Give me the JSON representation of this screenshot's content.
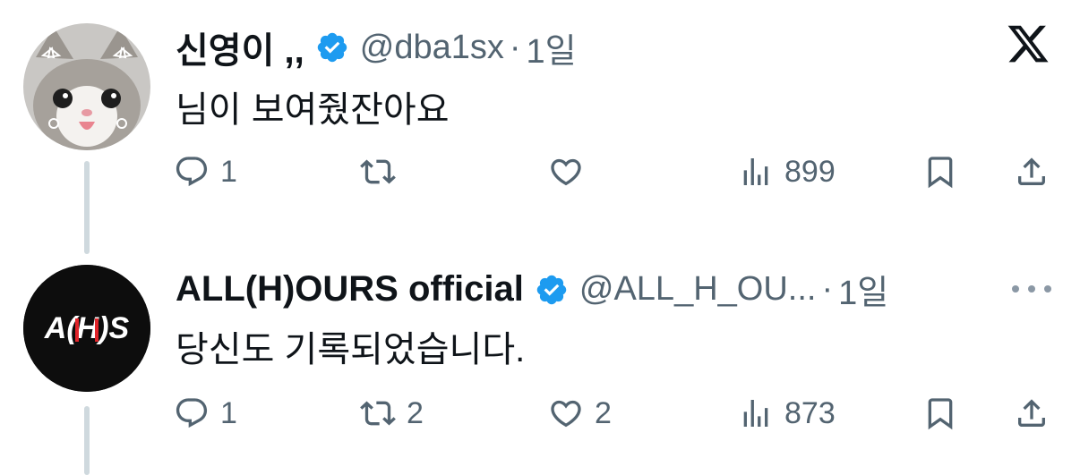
{
  "tweets": [
    {
      "display_name": "신영이 ,,",
      "handle": "@dba1sx",
      "separator": "·",
      "time": "1일",
      "text": "님이 보여줬잔아요",
      "avatar": "cat-avatar-with-ribbons",
      "actions": {
        "reply": {
          "icon": "reply-icon",
          "count": "1"
        },
        "repost": {
          "icon": "repost-icon",
          "count": ""
        },
        "like": {
          "icon": "heart-icon",
          "count": ""
        },
        "views": {
          "icon": "views-icon",
          "count": "899"
        },
        "bookmark": {
          "icon": "bookmark-icon"
        },
        "share": {
          "icon": "share-icon"
        }
      }
    },
    {
      "display_name": "ALL(H)OURS official",
      "handle": "@ALL_H_OU...",
      "separator": "·",
      "time": "1일",
      "text": "당신도 기록되었습니다.",
      "avatar": "allhours-logo",
      "avatar_logo_text": "A(H)S",
      "actions": {
        "reply": {
          "icon": "reply-icon",
          "count": "1"
        },
        "repost": {
          "icon": "repost-icon",
          "count": "2"
        },
        "like": {
          "icon": "heart-icon",
          "count": "2"
        },
        "views": {
          "icon": "views-icon",
          "count": "873"
        },
        "bookmark": {
          "icon": "bookmark-icon"
        },
        "share": {
          "icon": "share-icon"
        }
      }
    }
  ],
  "colors": {
    "text_primary": "#0f1419",
    "text_secondary": "#536471",
    "verified_blue": "#1d9bf0",
    "thread_line": "#cfd9de",
    "logo_red": "#e0242a"
  },
  "icons": {
    "platform": "x-logo-icon",
    "more": "more-dots-icon"
  }
}
